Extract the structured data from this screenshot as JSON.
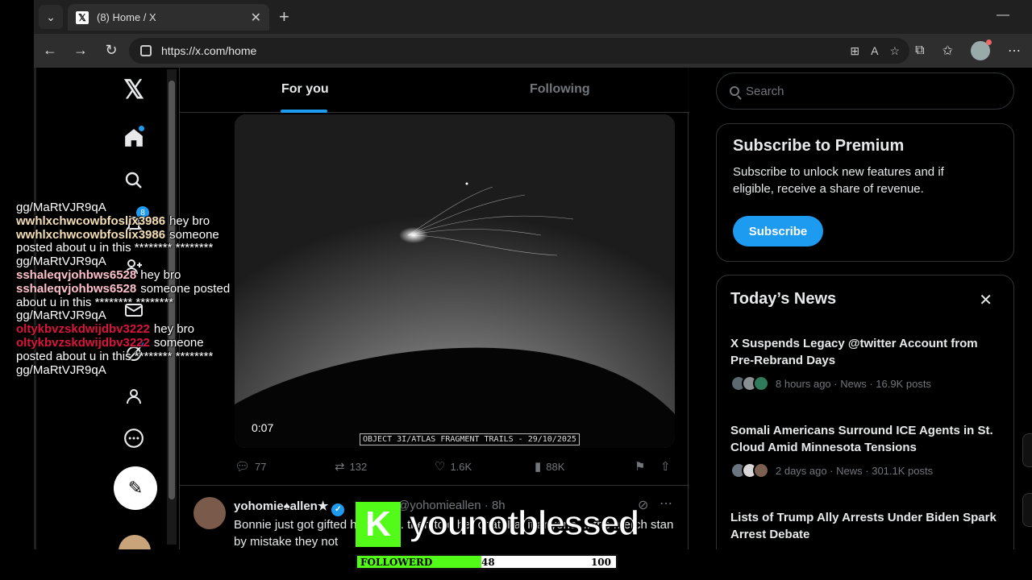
{
  "browser": {
    "tab_title": "(8) Home / X",
    "url": "https://x.com/home"
  },
  "nav": {
    "notifications_badge": "8"
  },
  "feed": {
    "tabs": [
      "For you",
      "Following"
    ],
    "media": {
      "duration": "0:07",
      "caption": "OBJECT 3I/ATLAS FRAGMENT TRAILS - 29/10/2025"
    },
    "actions": {
      "replies": "77",
      "reposts": "132",
      "likes": "1.6K",
      "views": "88K"
    },
    "post2": {
      "name": "yohomie♠allen★",
      "handle": "@yohomieallen · 8h",
      "body": "Bonnie just got gifted her first ... then told her chat that if anyone ... the merch stan by mistake they not"
    }
  },
  "sidebar": {
    "search_placeholder": "Search",
    "premium": {
      "title": "Subscribe to Premium",
      "text": "Subscribe to unlock new features and if eligible, receive a share of revenue.",
      "button": "Subscribe"
    },
    "news": {
      "title": "Today’s News",
      "items": [
        {
          "headline": "X Suspends Legacy @twitter Account from Pre-Rebrand Days",
          "meta": "8 hours ago · News · 16.9K posts"
        },
        {
          "headline": "Somali Americans Surround ICE Agents in St. Cloud Amid Minnesota Tensions",
          "meta": "2 days ago · News · 301.1K posts"
        },
        {
          "headline": "Lists of Trump Ally Arrests Under Biden Spark Arrest Debate",
          "meta": ""
        }
      ]
    }
  },
  "chat": {
    "messages": [
      {
        "user": "",
        "color": "#ffffff",
        "text": "gg/MaRtVJR9qA"
      },
      {
        "user": "wwhlxchwcowbfoslix3986",
        "color": "#f5deb3",
        "text": "hey bro"
      },
      {
        "user": "wwhlxchwcowbfoslix3986",
        "color": "#f5deb3",
        "text": "someone posted about u in this ******** ******** gg/MaRtVJR9qA"
      },
      {
        "user": "sshaleqvjohbws6528",
        "color": "#ffc0cb",
        "text": "hey bro"
      },
      {
        "user": "sshaleqvjohbws6528",
        "color": "#ffc0cb",
        "text": "someone posted about u in this ******** ******** gg/MaRtVJR9qA"
      },
      {
        "user": "oltykbvzskdwijdbv3222",
        "color": "#dc143c",
        "text": "hey bro"
      },
      {
        "user": "oltykbvzskdwijdbv3222",
        "color": "#dc143c",
        "text": "someone posted about u in this ******** ******** gg/MaRtVJR9qA"
      }
    ]
  },
  "stream": {
    "channel": "younotblessed",
    "follow_label": "FOLLOWERD",
    "follow_current": 48,
    "follow_goal": 100,
    "brand_color": "#53fc18"
  }
}
